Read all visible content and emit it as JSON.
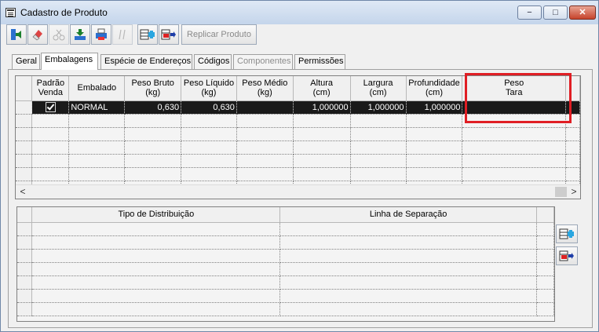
{
  "window": {
    "title": "Cadastro de Produto",
    "minimize": "−",
    "maximize": "□",
    "close": "✕"
  },
  "toolbar": {
    "replicate_label": "Replicar Produto",
    "icons": [
      "exit-icon",
      "eraser-icon",
      "cut-icon",
      "download-icon",
      "print-icon",
      "separator",
      "add-row-icon",
      "remove-row-icon"
    ]
  },
  "tabs": [
    {
      "label": "Geral",
      "active": false,
      "enabled": true
    },
    {
      "label": "Embalagens",
      "active": true,
      "enabled": true
    },
    {
      "label": "Espécie de Endereços",
      "active": false,
      "enabled": true
    },
    {
      "label": "Códigos",
      "active": false,
      "enabled": true
    },
    {
      "label": "Componentes",
      "active": false,
      "enabled": false
    },
    {
      "label": "Permissões",
      "active": false,
      "enabled": true
    }
  ],
  "packaging_grid": {
    "columns": {
      "padrao": [
        "Padrão",
        "Venda"
      ],
      "embalado": "Embalado",
      "peso_bruto": [
        "Peso Bruto",
        "(kg)"
      ],
      "peso_liquido": [
        "Peso Líquido",
        "(kg)"
      ],
      "peso_medio": [
        "Peso Médio",
        "(kg)"
      ],
      "altura": [
        "Altura",
        "(cm)"
      ],
      "largura": [
        "Largura",
        "(cm)"
      ],
      "profundidade": [
        "Profundidade",
        "(cm)"
      ],
      "peso_tara": [
        "Peso",
        "Tara"
      ]
    },
    "row": {
      "padrao_venda": true,
      "embalado": "NORMAL",
      "peso_bruto": "0,630",
      "peso_liquido": "0,630",
      "peso_medio": "",
      "altura": "1,000000",
      "largura": "1,000000",
      "profundidade": "1,000000",
      "peso_tara": ""
    },
    "scroll_left": "<",
    "scroll_right": ">"
  },
  "distribution_grid": {
    "columns": {
      "tipo": "Tipo de Distribuição",
      "linha": "Linha de Separação"
    }
  },
  "colors": {
    "highlight": "#e01e24",
    "selected_row": "#1a1a1a"
  }
}
